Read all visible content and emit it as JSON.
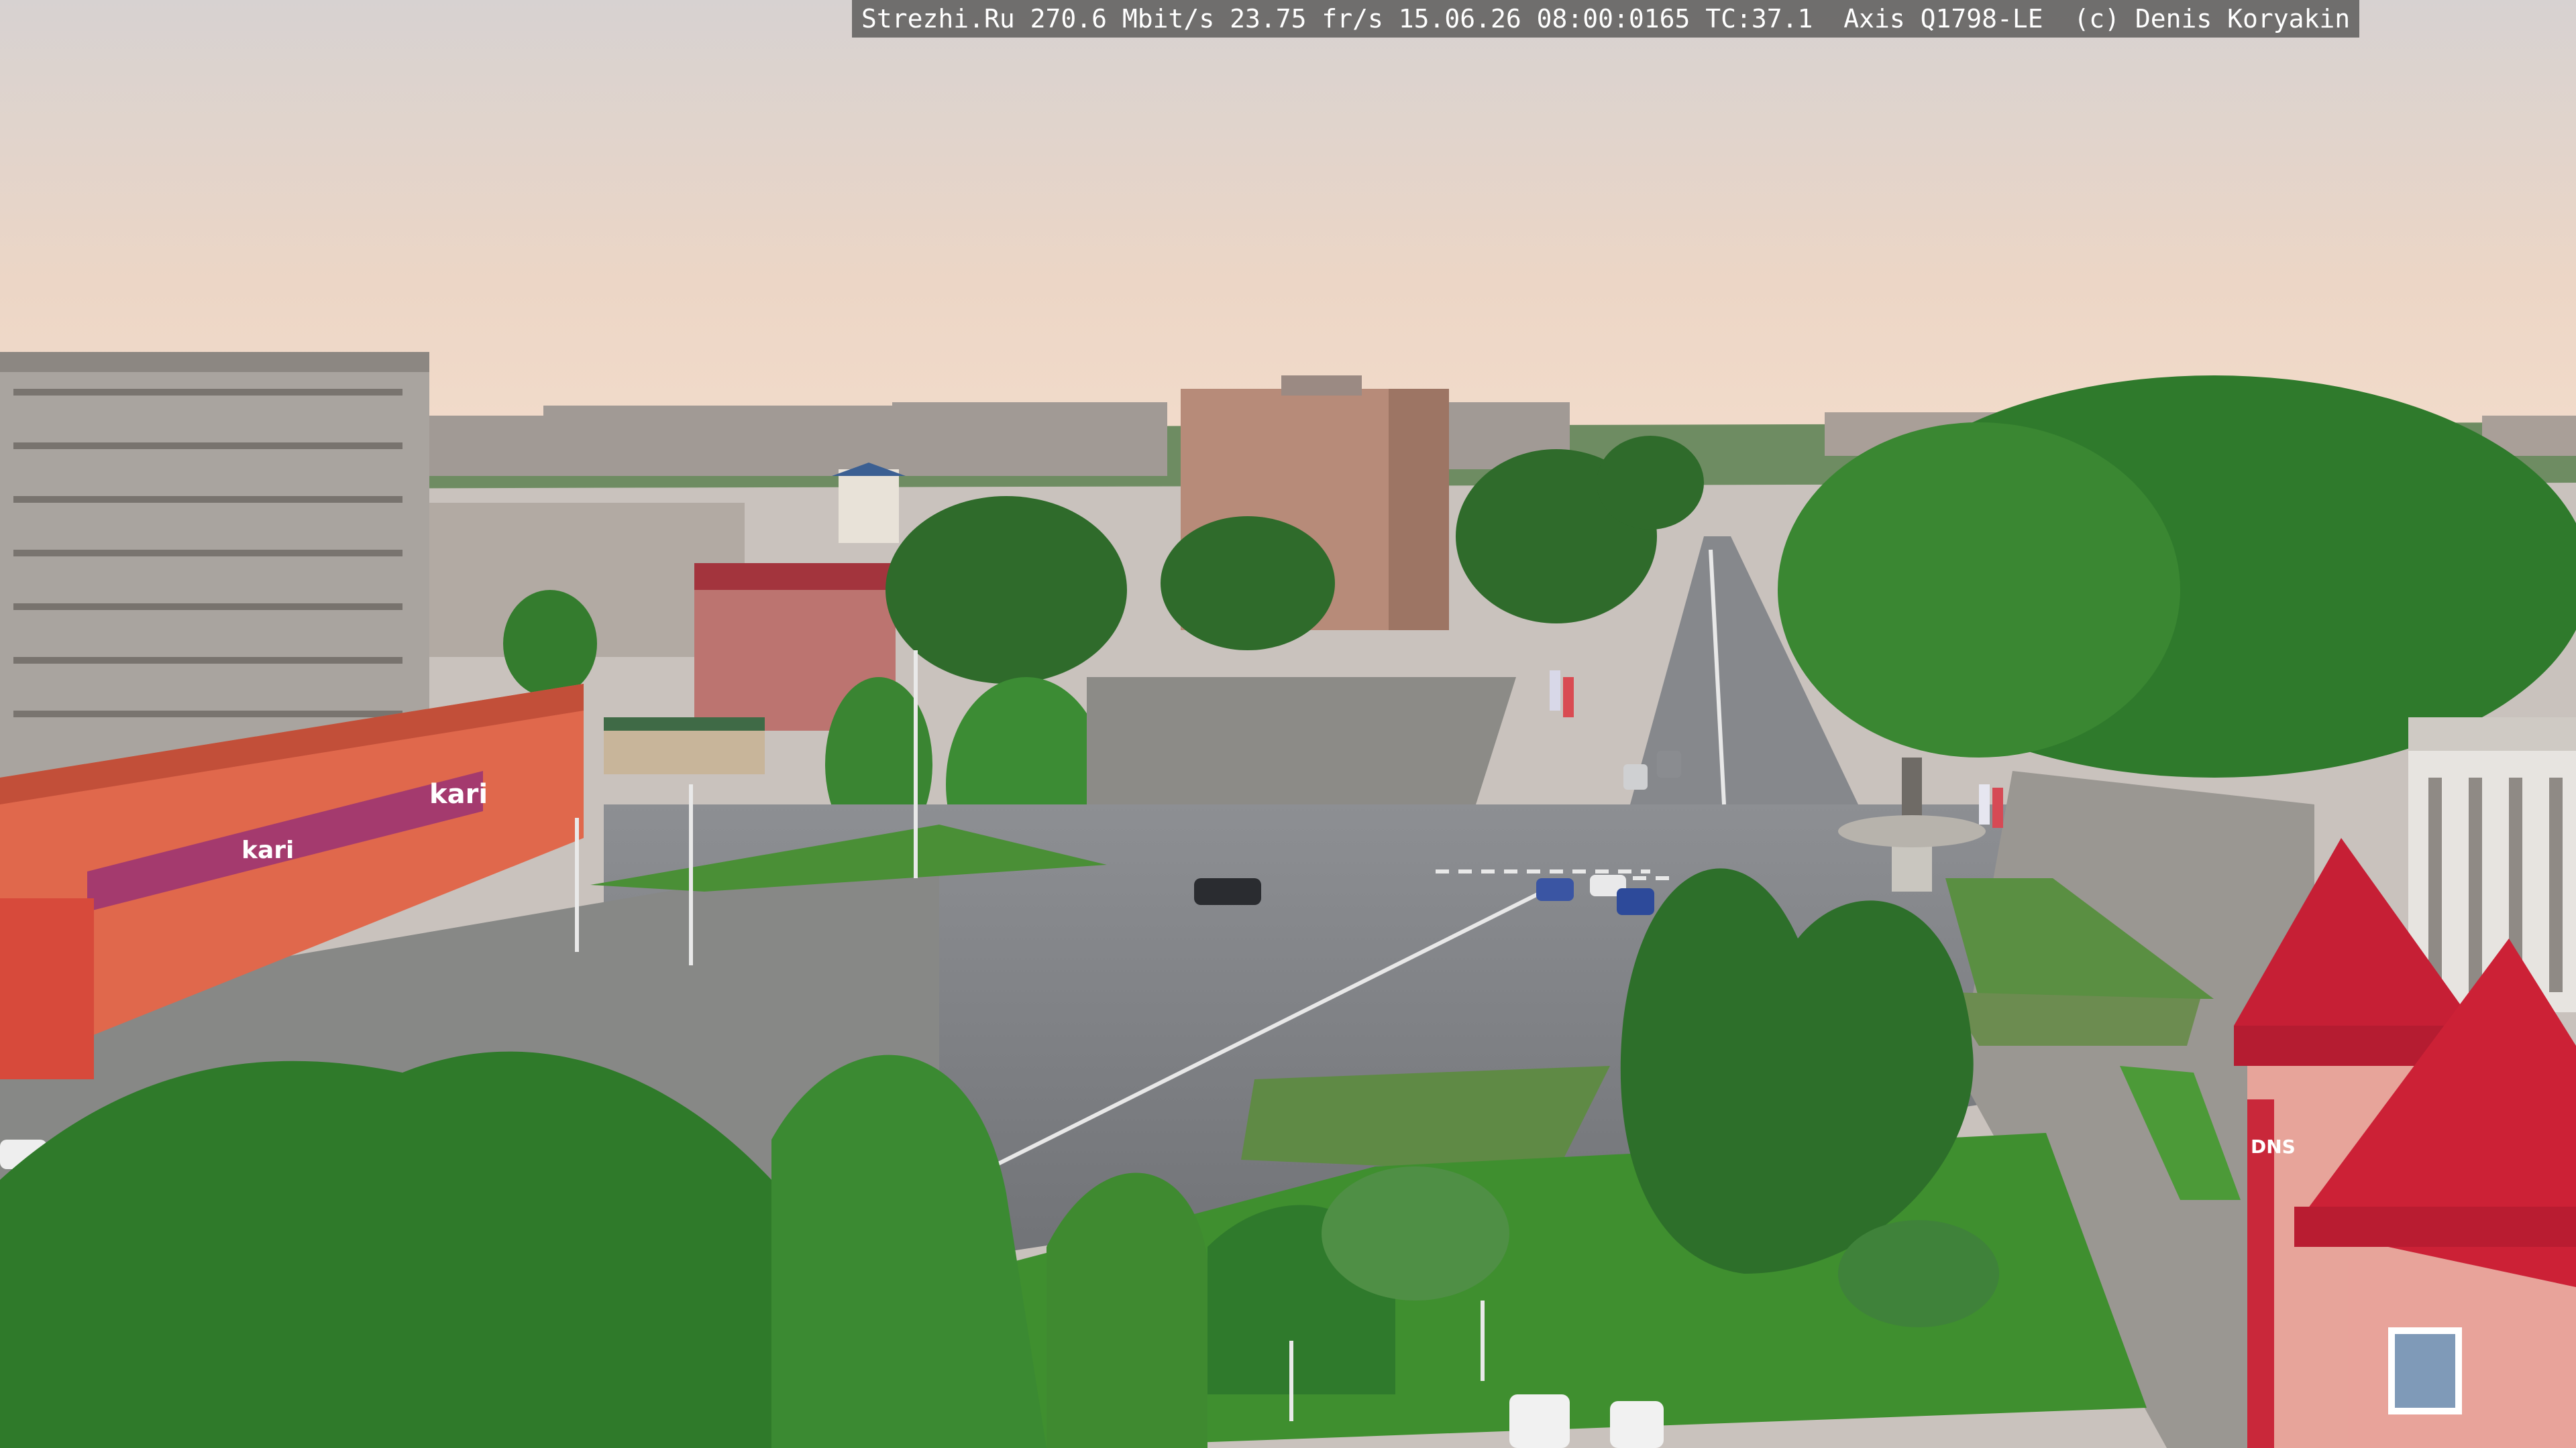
{
  "overlay": {
    "text": "Strezhi.Ru 270.6 Mbit/s 23.75 fr/s 15.06.26 08:00:0165 TC:37.1  Axis Q1798-LE  (c) Denis Koryakin"
  },
  "signs": {
    "store_left": "kari",
    "store_mid": "kari",
    "store_right": "DNS"
  },
  "colors": {
    "sky_top": "#ddd3cc",
    "sky_bottom": "#f0d9c8",
    "road": "#7f8185",
    "grass": "#3f8c2f",
    "trees": "#2f6f28",
    "building_brick": "#b58a77",
    "building_panel": "#a7a39e",
    "store_front": "#e06a4e",
    "store_banner": "#a43a6e",
    "tower_red": "#c61f35"
  }
}
